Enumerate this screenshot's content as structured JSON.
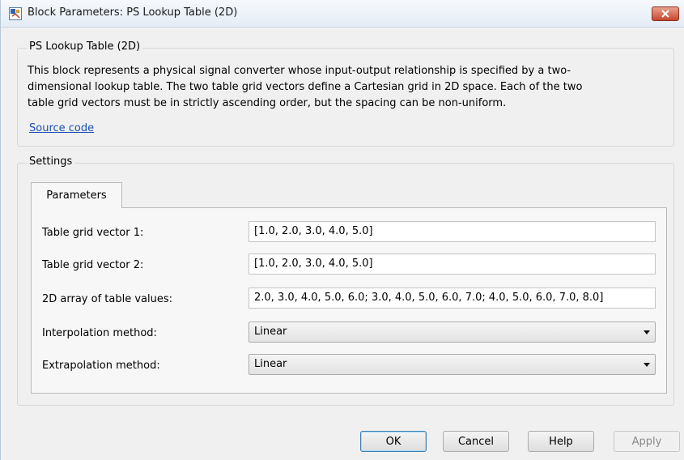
{
  "window": {
    "title": "Block Parameters: PS Lookup Table (2D)"
  },
  "block": {
    "group_label": "PS Lookup Table (2D)",
    "description_lines": [
      "This block represents a physical signal converter whose input-output relationship is specified by a two-",
      "dimensional lookup table. The two table grid vectors define a Cartesian grid in 2D space. Each of the two",
      "table grid vectors must be in strictly ascending order, but the spacing can be non-uniform."
    ],
    "source_link": "Source code"
  },
  "settings": {
    "group_label": "Settings",
    "tab_label": "Parameters",
    "fields": [
      {
        "label": "Table grid vector 1:",
        "value": "[1.0, 2.0, 3.0, 4.0, 5.0]"
      },
      {
        "label": "Table grid vector 2:",
        "value": "[1.0, 2.0, 3.0, 4.0, 5.0]"
      },
      {
        "label": "2D array of table values:",
        "value": "2.0, 3.0, 4.0, 5.0, 6.0; 3.0, 4.0, 5.0, 6.0, 7.0; 4.0, 5.0, 6.0, 7.0, 8.0]"
      },
      {
        "label": "Interpolation method:",
        "value": "Linear"
      },
      {
        "label": "Extrapolation method:",
        "value": "Linear"
      }
    ]
  },
  "buttons": {
    "ok": "OK",
    "cancel": "Cancel",
    "help": "Help",
    "apply": "Apply"
  },
  "icons": {
    "app": "simulink-block-icon",
    "close": "close-icon",
    "dropdown": "chevron-down-icon"
  },
  "colors": {
    "close_button": "#c7472f",
    "link": "#1a4fb5",
    "default_button_border": "#3c7fb1"
  }
}
